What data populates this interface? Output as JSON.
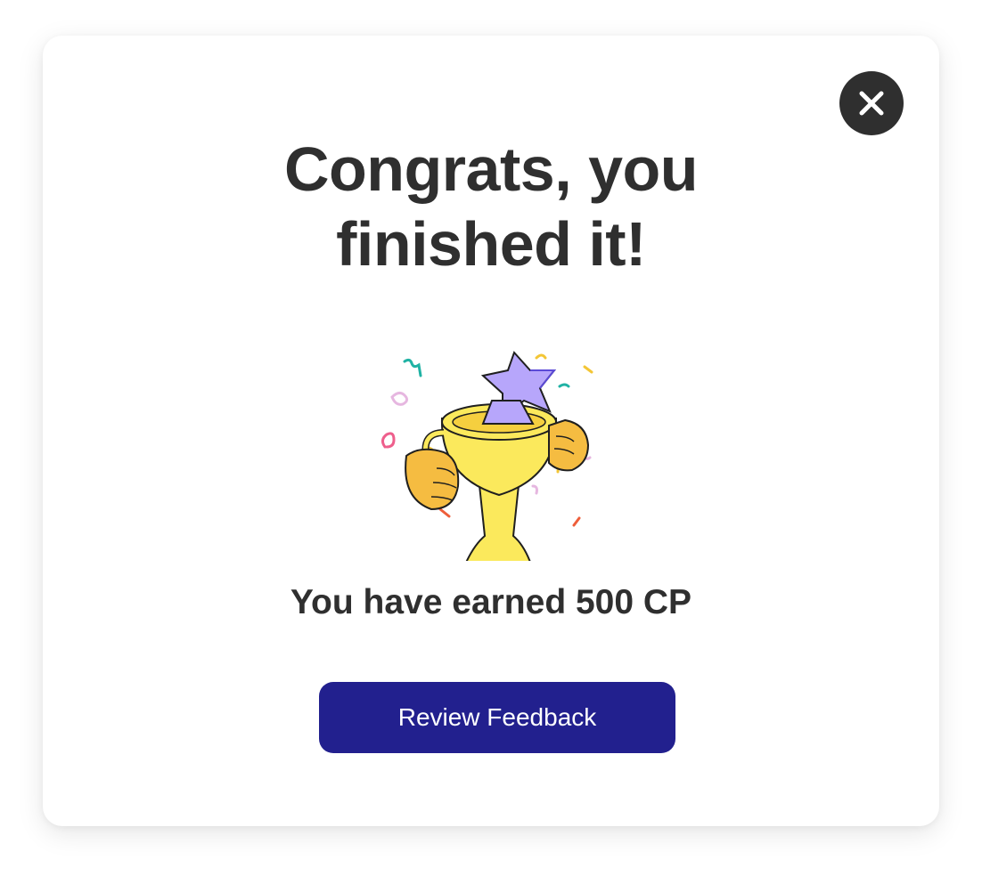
{
  "modal": {
    "title_line1": "Congrats, you",
    "title_line2": "finished it!",
    "earned_text": "You have earned 500 CP",
    "review_button_label": "Review Feedback",
    "close_icon": "close-icon",
    "illustration_icon": "trophy-with-star-icon"
  },
  "colors": {
    "text": "#2f2f2f",
    "primary_button": "#22208e",
    "close_button": "#2f2f2f",
    "trophy_yellow": "#fbe95c",
    "hand_orange": "#f5bc41",
    "star_purple": "#b7a6fb"
  }
}
